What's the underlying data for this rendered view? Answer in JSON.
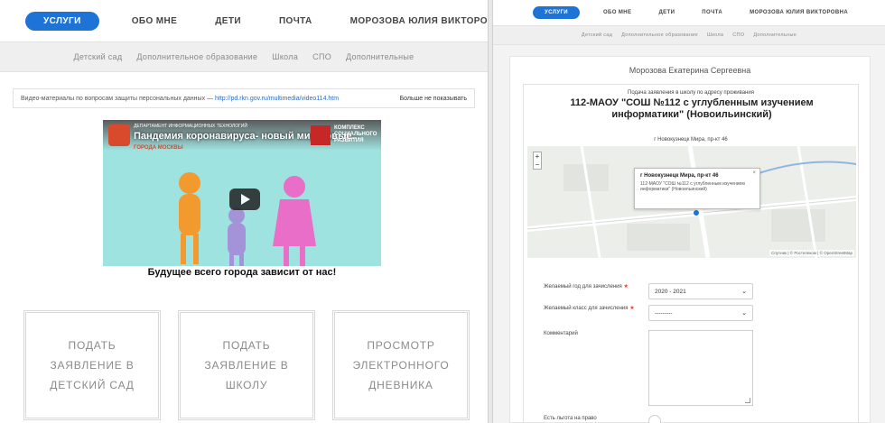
{
  "left": {
    "nav": {
      "items": [
        "УСЛУГИ",
        "ОБО МНЕ",
        "ДЕТИ",
        "ПОЧТА",
        "МОРОЗОВА ЮЛИЯ ВИКТОРОВНА"
      ]
    },
    "subnav": {
      "items": [
        "Детский сад",
        "Дополнительное образование",
        "Школа",
        "СПО",
        "Дополнительные"
      ]
    },
    "notice": {
      "text": "Видео-материалы по вопросам защиты персональных данных —",
      "link": "http://pd.rkn.gov.ru/multimedia/video114.htm",
      "dismiss": "Больше не показывать"
    },
    "video": {
      "title": "Пандемия коронавируса- новый мир-новые...",
      "org_left": "ДЕПАРТАМЕНТ ИНФОРМАЦИОННЫХ ТЕХНОЛОГИЙ",
      "city": "ГОРОДА МОСКВЫ",
      "org_right": "КОМПЛЕКС СОЦИАЛЬНОГО РАЗВИТИЯ",
      "caption": "Будущее всего города зависит от нас!"
    },
    "cards": [
      {
        "label": "ПОДАТЬ ЗАЯВЛЕНИЕ В ДЕТСКИЙ САД"
      },
      {
        "label": "ПОДАТЬ ЗАЯВЛЕНИЕ В ШКОЛУ"
      },
      {
        "label": "ПРОСМОТР ЭЛЕКТРОННОГО ДНЕВНИКА"
      }
    ]
  },
  "right": {
    "nav": {
      "items": [
        "УСЛУГИ",
        "ОБО МНЕ",
        "ДЕТИ",
        "ПОЧТА",
        "МОРОЗОВА ЮЛИЯ ВИКТОРОВНА"
      ]
    },
    "subnav": {
      "items": [
        "Детский сад",
        "Дополнительное образование",
        "Школа",
        "СПО",
        "Дополнительные"
      ]
    },
    "person": "Морозова Екатерина Сергеевна",
    "form": {
      "subtitle": "Подача заявления в школу по адресу проживания",
      "school": "112-МАОУ \"СОШ №112 с углубленным изучением информатики\" (Новоильинский)",
      "address": "г Новокузнецк Мира, пр-кт 46",
      "map": {
        "zoom_in": "+",
        "zoom_out": "−",
        "popup_title": "г Новокузнецк Мира, пр-кт 46",
        "popup_text": "112-МАОУ \"СОШ №112 с углубленным изучением информатики\" (Новоильинский)",
        "popup_close": "×",
        "attribution": "Спутник | © Ростелеком | © OpenStreetMap"
      },
      "fields": [
        {
          "label": "Желаемый год для зачисления",
          "value": "2020 - 2021"
        },
        {
          "label": "Желаемый класс для зачисления",
          "value": "---------"
        },
        {
          "label": "Комментарий",
          "value": ""
        },
        {
          "label": "Есть льгота на право преимущественного приема",
          "value": ""
        }
      ]
    }
  },
  "colors": {
    "accent": "#1e73d7",
    "required": "#e53935"
  }
}
